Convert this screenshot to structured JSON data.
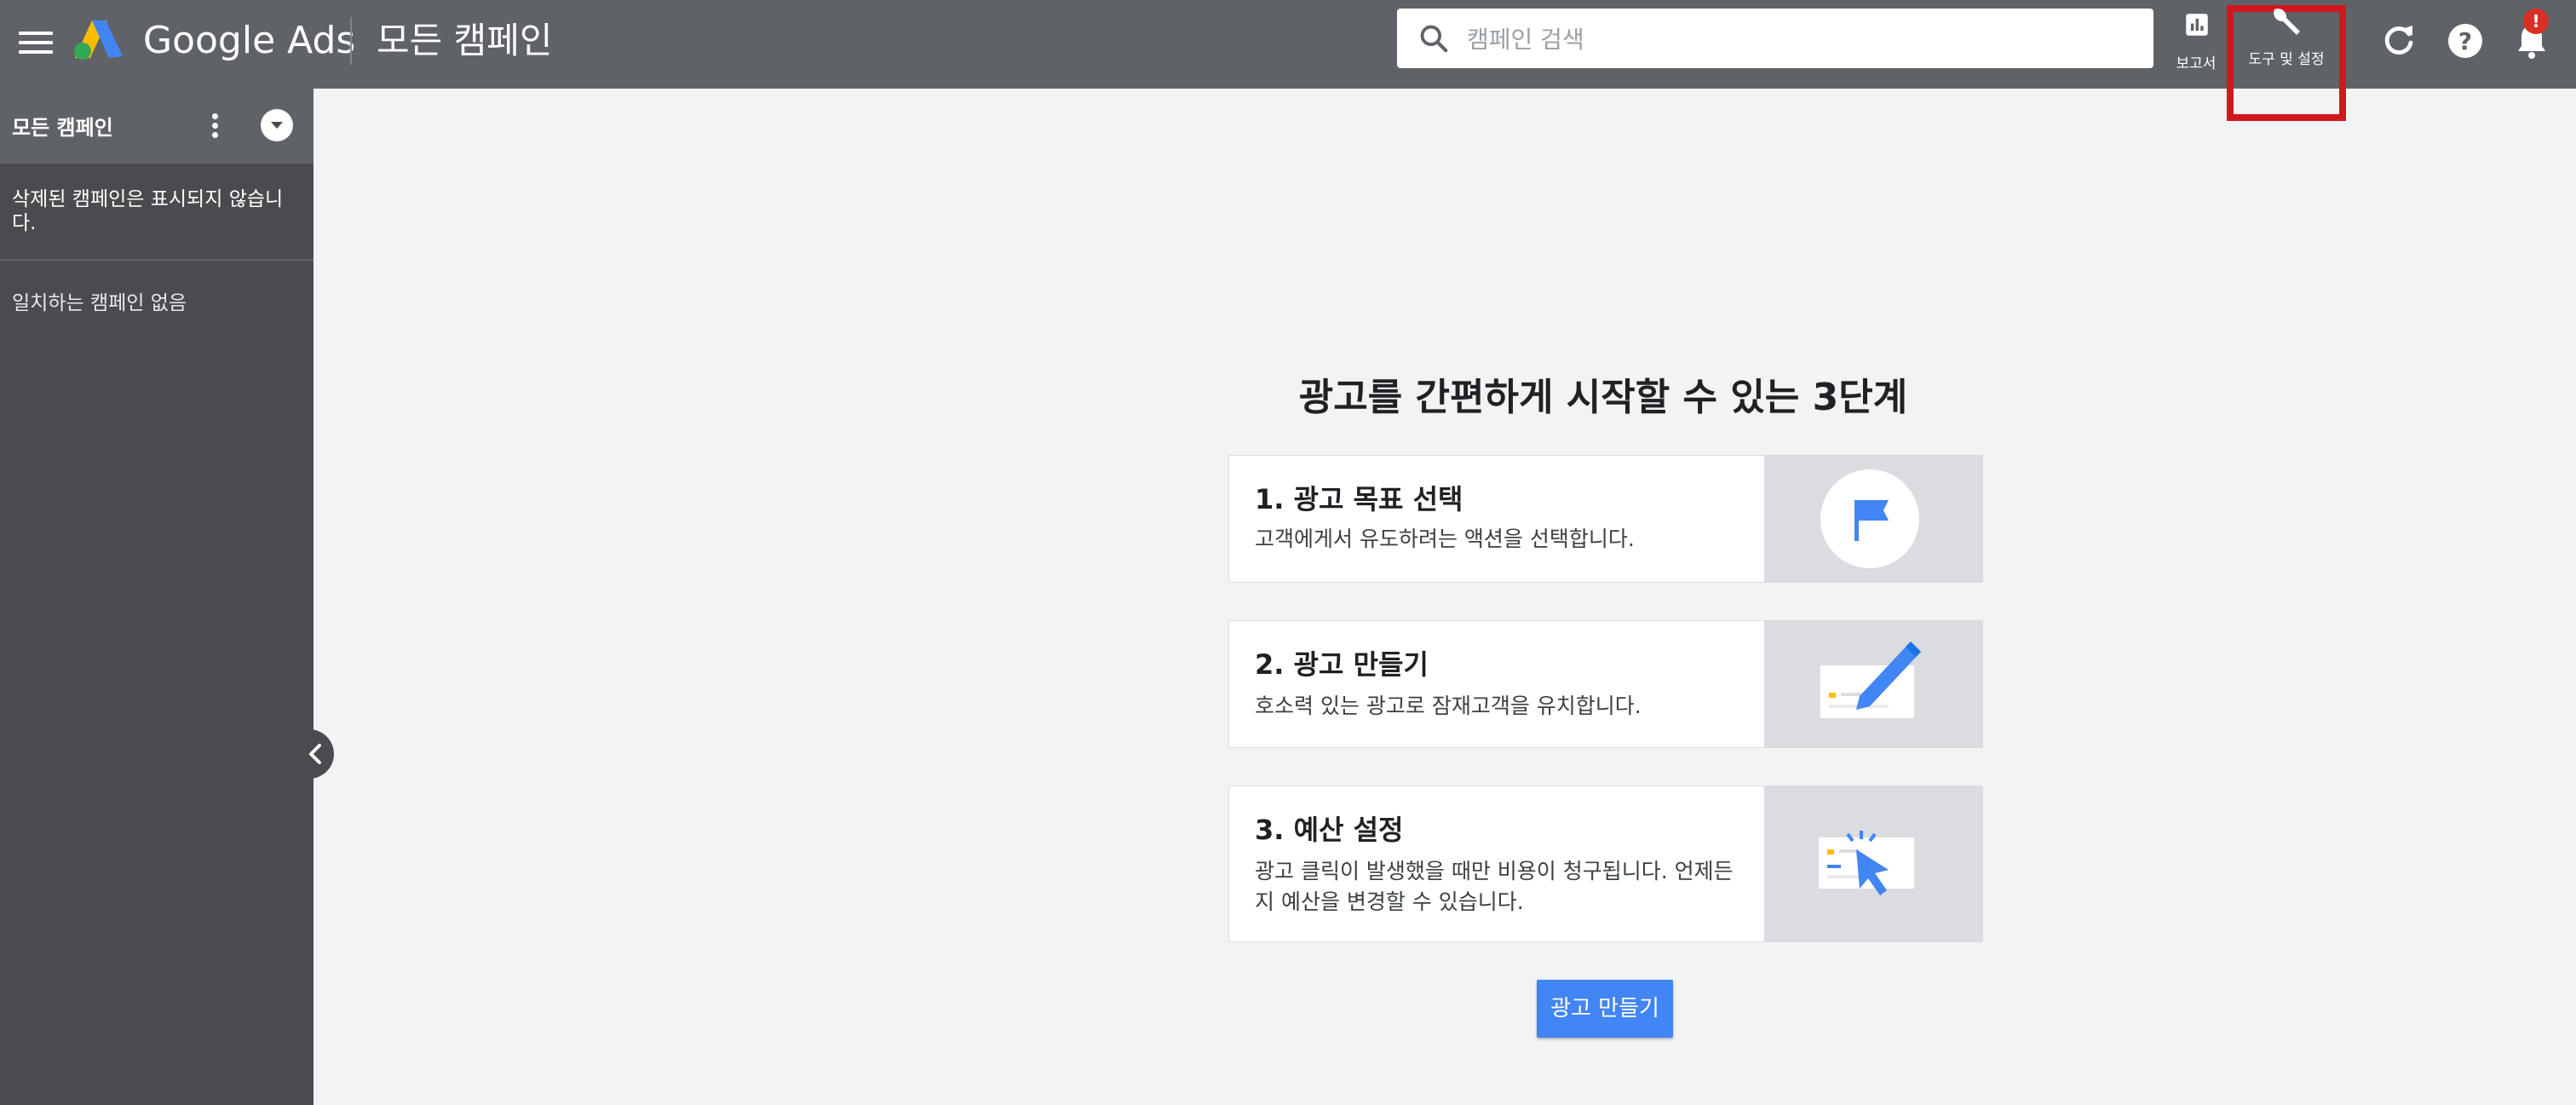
{
  "header": {
    "brand": "Google Ads",
    "page_title": "모든 캠페인",
    "search_placeholder": "캠페인 검색",
    "reports_label": "보고서",
    "tools_label": "도구 및 설정",
    "notification_badge": "!"
  },
  "sidebar": {
    "title": "모든 캠페인",
    "deleted_note": "삭제된 캠페인은 표시되지 않습니다.",
    "empty_label": "일치하는 캠페인 없음"
  },
  "main": {
    "heading": "광고를 간편하게 시작할 수 있는 3단계",
    "steps": [
      {
        "title": "1. 광고 목표 선택",
        "desc": "고객에게서 유도하려는 액션을 선택합니다."
      },
      {
        "title": "2. 광고 만들기",
        "desc": "호소력 있는 광고로 잠재고객을 유치합니다."
      },
      {
        "title": "3. 예산 설정",
        "desc": "광고 클릭이 발생했을 때만 비용이 청구됩니다. 언제든지 예산을 변경할 수 있습니다."
      }
    ],
    "cta_label": "광고 만들기"
  },
  "colors": {
    "topbar": "#5f6368",
    "sidebar": "#4a4b4e",
    "accent_blue": "#4285f4",
    "highlight_red": "#d0191f"
  }
}
